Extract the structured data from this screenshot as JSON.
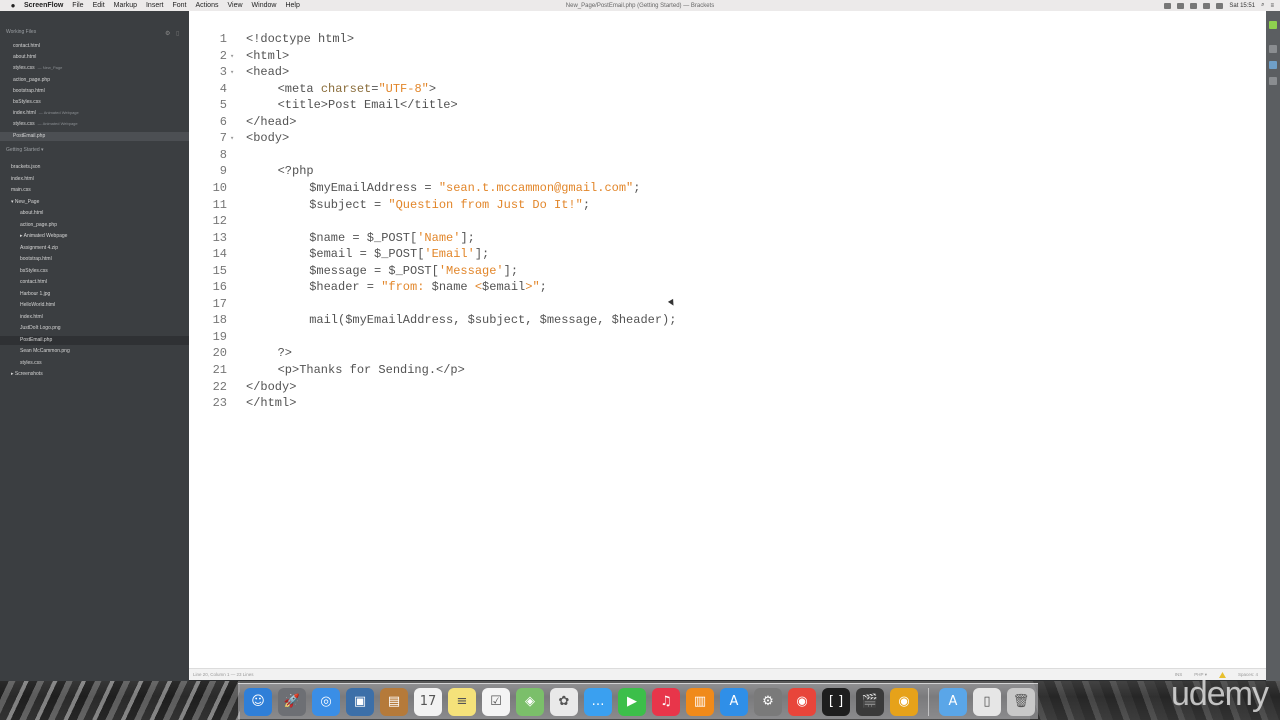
{
  "menubar": {
    "app_name": "ScreenFlow",
    "items": [
      "File",
      "Edit",
      "Markup",
      "Insert",
      "Font",
      "Actions",
      "View",
      "Window",
      "Help"
    ],
    "window_title": "New_Page/PostEmail.php (Getting Started) — Brackets",
    "clock": "Sat 15:51"
  },
  "sidebar": {
    "working_files_title": "Working Files",
    "working_files": [
      {
        "name": "contact.html",
        "sub": ""
      },
      {
        "name": "about.html",
        "sub": ""
      },
      {
        "name": "styles.css",
        "sub": "— New_Page"
      },
      {
        "name": "action_page.php",
        "sub": ""
      },
      {
        "name": "bootstrap.html",
        "sub": ""
      },
      {
        "name": "bsStyles.css",
        "sub": ""
      },
      {
        "name": "index.html",
        "sub": "— Animated Webpage"
      },
      {
        "name": "styles.css",
        "sub": "— Animated Webpage"
      },
      {
        "name": "PostEmail.php",
        "sub": ""
      }
    ],
    "project_title": "Getting Started ▾",
    "tree": [
      {
        "name": "brackets.json",
        "indent": 0
      },
      {
        "name": "index.html",
        "indent": 0
      },
      {
        "name": "main.css",
        "indent": 0
      },
      {
        "name": "▾ New_Page",
        "indent": 0
      },
      {
        "name": "about.html",
        "indent": 1
      },
      {
        "name": "action_page.php",
        "indent": 1
      },
      {
        "name": "▸ Animated Webpage",
        "indent": 1
      },
      {
        "name": "Assignment 4.zip",
        "indent": 1
      },
      {
        "name": "bootstrap.html",
        "indent": 1
      },
      {
        "name": "bsStyles.css",
        "indent": 1
      },
      {
        "name": "contact.html",
        "indent": 1
      },
      {
        "name": "Harbour 1.jpg",
        "indent": 1
      },
      {
        "name": "HelloWorld.html",
        "indent": 1
      },
      {
        "name": "index.html",
        "indent": 1
      },
      {
        "name": "JustDoIt Logo.png",
        "indent": 1
      },
      {
        "name": "PostEmail.php",
        "indent": 1
      },
      {
        "name": "Sean McCammon.png",
        "indent": 1
      },
      {
        "name": "styles.css",
        "indent": 1
      },
      {
        "name": "▸ Screenshots",
        "indent": 0
      }
    ]
  },
  "editor": {
    "lines": [
      {
        "n": "1",
        "fold": "",
        "indent": 0,
        "parts": [
          [
            "tag",
            "<!doctype html>"
          ]
        ]
      },
      {
        "n": "2",
        "fold": "▾",
        "indent": 0,
        "parts": [
          [
            "tag",
            "<html>"
          ]
        ]
      },
      {
        "n": "3",
        "fold": "▾",
        "indent": 0,
        "parts": [
          [
            "tag",
            "<head>"
          ]
        ]
      },
      {
        "n": "4",
        "fold": "",
        "indent": 1,
        "parts": [
          [
            "tag",
            "<meta "
          ],
          [
            "attr",
            "charset"
          ],
          [
            "tag",
            "="
          ],
          [
            "str",
            "\"UTF-8\""
          ],
          [
            "tag",
            ">"
          ]
        ]
      },
      {
        "n": "5",
        "fold": "",
        "indent": 1,
        "parts": [
          [
            "tag",
            "<title>"
          ],
          [
            "var",
            "Post Email"
          ],
          [
            "tag",
            "</title>"
          ]
        ]
      },
      {
        "n": "6",
        "fold": "",
        "indent": 0,
        "parts": [
          [
            "tag",
            "</head>"
          ]
        ]
      },
      {
        "n": "7",
        "fold": "▾",
        "indent": 0,
        "parts": [
          [
            "tag",
            "<body>"
          ]
        ]
      },
      {
        "n": "8",
        "fold": "",
        "indent": 0,
        "parts": []
      },
      {
        "n": "9",
        "fold": "",
        "indent": 1,
        "parts": [
          [
            "tag",
            "<?php"
          ]
        ]
      },
      {
        "n": "10",
        "fold": "",
        "indent": 2,
        "parts": [
          [
            "var",
            "$myEmailAddress = "
          ],
          [
            "str",
            "\"sean.t.mccammon@gmail.com\""
          ],
          [
            "var",
            ";"
          ]
        ]
      },
      {
        "n": "11",
        "fold": "",
        "indent": 2,
        "parts": [
          [
            "var",
            "$subject = "
          ],
          [
            "str",
            "\"Question from Just Do It!\""
          ],
          [
            "var",
            ";"
          ]
        ]
      },
      {
        "n": "12",
        "fold": "",
        "indent": 0,
        "parts": []
      },
      {
        "n": "13",
        "fold": "",
        "indent": 2,
        "parts": [
          [
            "var",
            "$name = $_POST["
          ],
          [
            "str",
            "'Name'"
          ],
          [
            "var",
            "];"
          ]
        ]
      },
      {
        "n": "14",
        "fold": "",
        "indent": 2,
        "parts": [
          [
            "var",
            "$email = $_POST["
          ],
          [
            "str",
            "'Email'"
          ],
          [
            "var",
            "];"
          ]
        ]
      },
      {
        "n": "15",
        "fold": "",
        "indent": 2,
        "parts": [
          [
            "var",
            "$message = $_POST["
          ],
          [
            "str",
            "'Message'"
          ],
          [
            "var",
            "];"
          ]
        ]
      },
      {
        "n": "16",
        "fold": "",
        "indent": 2,
        "parts": [
          [
            "var",
            "$header = "
          ],
          [
            "str",
            "\"from: "
          ],
          [
            "var",
            "$name"
          ],
          [
            "str",
            " <"
          ],
          [
            "var",
            "$email"
          ],
          [
            "str",
            ">\""
          ],
          [
            "var",
            ";"
          ]
        ]
      },
      {
        "n": "17",
        "fold": "",
        "indent": 0,
        "parts": []
      },
      {
        "n": "18",
        "fold": "",
        "indent": 2,
        "parts": [
          [
            "var",
            "mail($myEmailAddress, $subject, $message, $header);"
          ]
        ]
      },
      {
        "n": "19",
        "fold": "",
        "indent": 0,
        "parts": []
      },
      {
        "n": "20",
        "fold": "",
        "indent": 1,
        "parts": [
          [
            "tag",
            "?>"
          ]
        ]
      },
      {
        "n": "21",
        "fold": "",
        "indent": 1,
        "parts": [
          [
            "tag",
            "<p>"
          ],
          [
            "var",
            "Thanks for Sending."
          ],
          [
            "tag",
            "</p>"
          ]
        ]
      },
      {
        "n": "22",
        "fold": "",
        "indent": 0,
        "parts": [
          [
            "tag",
            "</body>"
          ]
        ]
      },
      {
        "n": "23",
        "fold": "",
        "indent": 0,
        "parts": [
          [
            "tag",
            "</html>"
          ]
        ]
      }
    ]
  },
  "statusbar": {
    "position": "Line 20, Column 1 — 23 Lines",
    "encoding": "INS",
    "language": "PHP ▾",
    "spaces": "Spaces: 4"
  },
  "dock": {
    "icons": [
      {
        "name": "finder-icon",
        "glyph": "☺",
        "color": "#2f7fd8"
      },
      {
        "name": "launchpad-icon",
        "glyph": "🚀",
        "color": "#6d6f74"
      },
      {
        "name": "safari-icon",
        "glyph": "◎",
        "color": "#3a8ee6"
      },
      {
        "name": "preview-icon",
        "glyph": "▣",
        "color": "#3c6fa8"
      },
      {
        "name": "contacts-icon",
        "glyph": "▤",
        "color": "#b57a3a"
      },
      {
        "name": "calendar-icon",
        "glyph": "17",
        "color": "#f2f2f2"
      },
      {
        "name": "notes-icon",
        "glyph": "≡",
        "color": "#f5e27a"
      },
      {
        "name": "reminders-icon",
        "glyph": "☑",
        "color": "#f4f4f4"
      },
      {
        "name": "maps-icon",
        "glyph": "◈",
        "color": "#7bbf6a"
      },
      {
        "name": "photos-icon",
        "glyph": "✿",
        "color": "#e9e9e9"
      },
      {
        "name": "messages-icon",
        "glyph": "…",
        "color": "#3aa0f0"
      },
      {
        "name": "facetime-icon",
        "glyph": "▶",
        "color": "#3cbf4a"
      },
      {
        "name": "itunes-icon",
        "glyph": "♫",
        "color": "#e8354a"
      },
      {
        "name": "ibooks-icon",
        "glyph": "▥",
        "color": "#f08a1a"
      },
      {
        "name": "app-store-icon",
        "glyph": "A",
        "color": "#2f8fe8"
      },
      {
        "name": "system-preferences-icon",
        "glyph": "⚙",
        "color": "#7a7a7a"
      },
      {
        "name": "chrome-icon",
        "glyph": "◉",
        "color": "#e8453a"
      },
      {
        "name": "brackets-icon",
        "glyph": "[ ]",
        "color": "#1e1e1e"
      },
      {
        "name": "screenflow-icon",
        "glyph": "🎬",
        "color": "#3a3a3a"
      },
      {
        "name": "chrome-canary-icon",
        "glyph": "◉",
        "color": "#e6a21a"
      },
      {
        "name": "applications-folder-icon",
        "glyph": "A",
        "color": "#5aa6e8"
      },
      {
        "name": "documents-folder-icon",
        "glyph": "▯",
        "color": "#e6e6e6"
      },
      {
        "name": "trash-icon",
        "glyph": "🗑",
        "color": "#c8c8c8"
      }
    ]
  },
  "watermark": "udemy",
  "colors": {
    "sidebar_bg": "#3b3e41",
    "editor_bg": "#ffffff",
    "string": "#e2862a",
    "tag": "#535353"
  }
}
